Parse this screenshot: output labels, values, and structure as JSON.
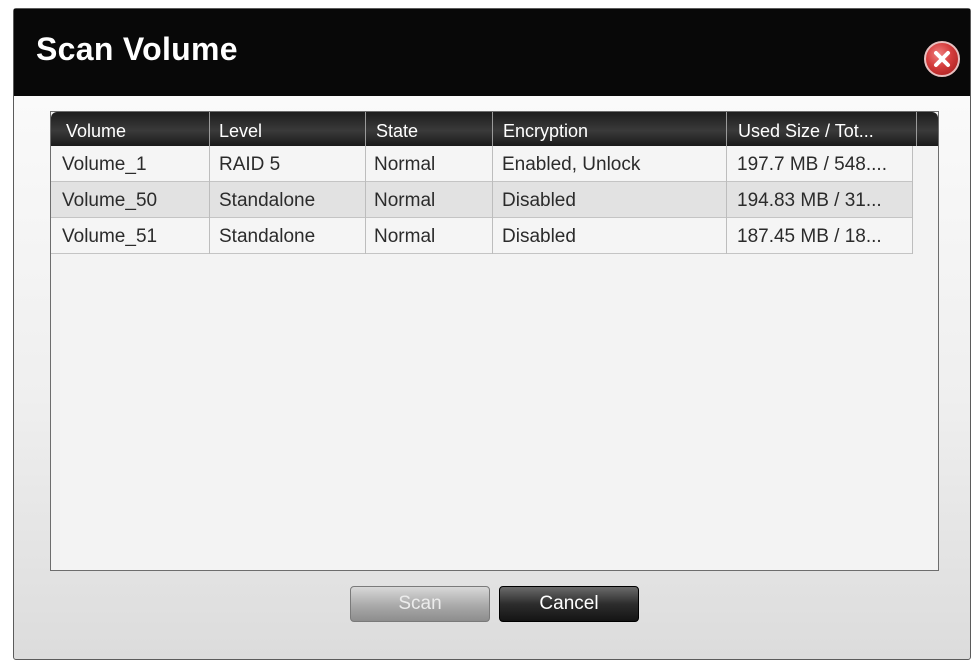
{
  "dialog": {
    "title": "Scan Volume",
    "close_icon": "close-x-icon",
    "accent_color": "#d43d3d"
  },
  "table": {
    "columns": [
      "Volume",
      "Level",
      "State",
      "Encryption",
      "Used Size / Tot..."
    ],
    "rows": [
      {
        "volume": "Volume_1",
        "level": "RAID 5",
        "state": "Normal",
        "encryption": "Enabled, Unlock",
        "used_size": "197.7 MB / 548...."
      },
      {
        "volume": "Volume_50",
        "level": "Standalone",
        "state": "Normal",
        "encryption": "Disabled",
        "used_size": "194.83 MB / 31..."
      },
      {
        "volume": "Volume_51",
        "level": "Standalone",
        "state": "Normal",
        "encryption": "Disabled",
        "used_size": "187.45 MB / 18..."
      }
    ]
  },
  "buttons": {
    "scan_label": "Scan",
    "cancel_label": "Cancel"
  }
}
